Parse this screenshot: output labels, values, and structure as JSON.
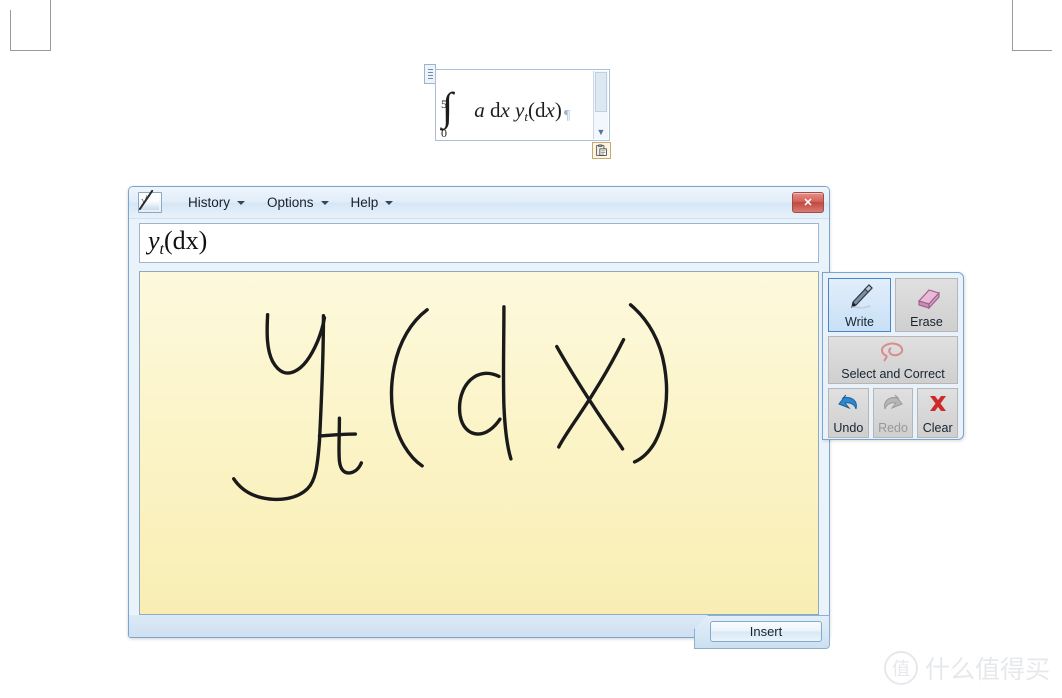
{
  "document": {
    "equation": {
      "integral_symbol": "∫",
      "upper_limit": "5",
      "lower_limit": "0",
      "body_a": "a",
      "body_dx": "d",
      "body_dx_var": "x",
      "body_y": "y",
      "body_y_sub": "t",
      "body_paren_open": "(d",
      "body_paren_var": "x",
      "body_paren_close": ")",
      "paragraph_mark": "¶",
      "scroll_down_arrow": "▼"
    },
    "paste_tag_icon": "clipboard-icon"
  },
  "window": {
    "app_icon": "math-input-panel-icon",
    "menus": [
      {
        "label": "History",
        "icon": "chevron-down-icon"
      },
      {
        "label": "Options",
        "icon": "chevron-down-icon"
      },
      {
        "label": "Help",
        "icon": "chevron-down-icon"
      }
    ],
    "close_label": "✕",
    "preview": {
      "y": "y",
      "y_sub": "t",
      "rest": "(dx)"
    },
    "footer": {
      "insert_label": "Insert"
    }
  },
  "tools": {
    "write": {
      "label": "Write",
      "icon": "pen-icon",
      "selected": true,
      "enabled": true
    },
    "erase": {
      "label": "Erase",
      "icon": "eraser-icon",
      "selected": false,
      "enabled": true
    },
    "select_and_correct": {
      "label": "Select and Correct",
      "icon": "lasso-icon",
      "selected": false,
      "enabled": true
    },
    "undo": {
      "label": "Undo",
      "icon": "undo-arrow-icon",
      "enabled": true
    },
    "redo": {
      "label": "Redo",
      "icon": "redo-arrow-icon",
      "enabled": false
    },
    "clear": {
      "label": "Clear",
      "icon": "red-x-icon",
      "enabled": true
    }
  },
  "canvas": {
    "handwriting_text": "y_t(dx)",
    "background_color": "#fbf3c4",
    "grid_color": "#c4b264",
    "ink_color": "#1a1a1a"
  },
  "watermark": {
    "mark": "值",
    "text": "什么值得买"
  },
  "colors": {
    "window_border": "#7ba4ce",
    "titlebar_top": "#eef5fc",
    "close_button": "#c0483f",
    "selected_tool": "#c8e0f6",
    "accent_blue": "#4a86c5"
  }
}
